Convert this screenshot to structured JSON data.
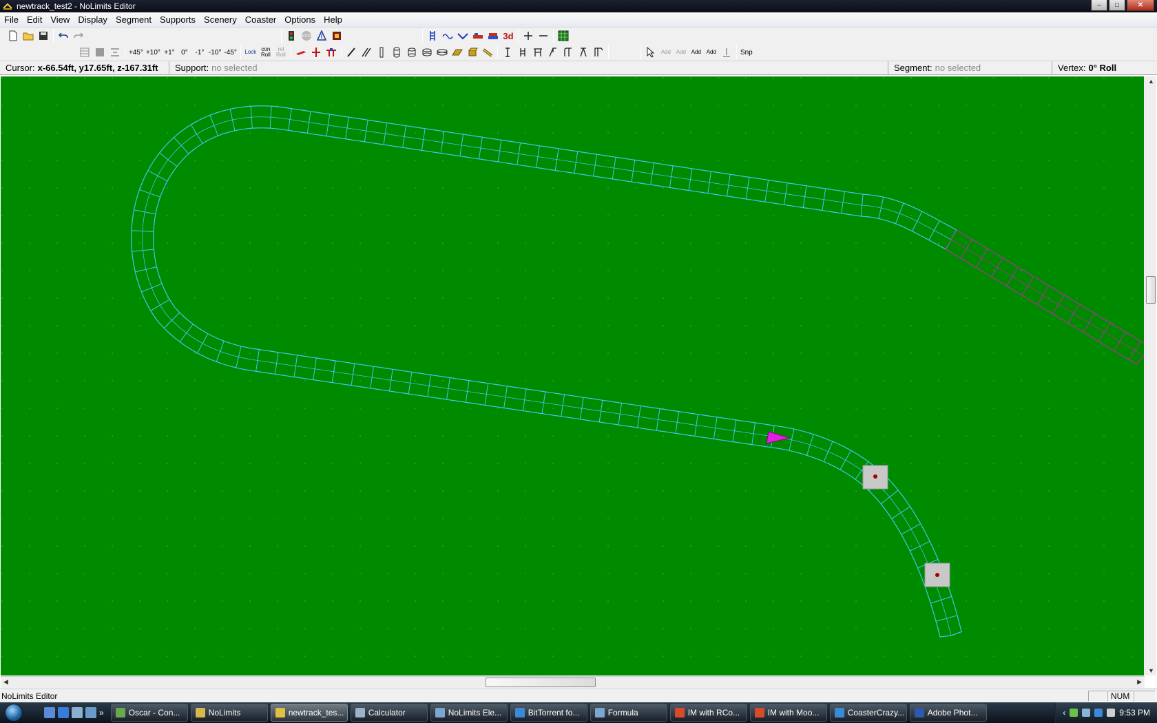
{
  "window": {
    "title": "newtrack_test2 - NoLimits Editor",
    "buttons": {
      "minimize": "–",
      "maximize": "□",
      "close": "✕"
    }
  },
  "menu": [
    "File",
    "Edit",
    "View",
    "Display",
    "Segment",
    "Supports",
    "Scenery",
    "Coaster",
    "Options",
    "Help"
  ],
  "toolbar2": {
    "rot_buttons": [
      "+45°",
      "+10°",
      "+1°",
      "0°",
      "-1°",
      "-10°",
      "-45°"
    ],
    "lock_roll": "Lock",
    "con_roll": "con Roll",
    "rel_roll": "rel Roll",
    "add_labels": [
      "Add",
      "Add",
      "Add",
      "Add"
    ],
    "snap": "Snp",
    "label_3d": "3d"
  },
  "info": {
    "cursor_label": "Cursor:",
    "cursor_value": "x-66.54ft, y17.65ft, z-167.31ft",
    "support_label": "Support:",
    "support_value": "no selected",
    "segment_label": "Segment:",
    "segment_value": "no selected",
    "vertex_label": "Vertex:",
    "vertex_value": "0° Roll"
  },
  "colors": {
    "ground": "#008a00",
    "track": "#3ec8f0",
    "track_selected": "#b030a0",
    "train_marker": "#e020e0",
    "support_base": "#c8c8c8"
  },
  "statusbar": {
    "text": "NoLimits Editor",
    "num": "NUM"
  },
  "taskbar": {
    "items": [
      {
        "label": "Oscar - Con...",
        "color": "#6aa84f"
      },
      {
        "label": "NoLimits",
        "color": "#d8b84a"
      },
      {
        "label": "newtrack_tes...",
        "color": "#e0c040",
        "active": true
      },
      {
        "label": "Calculator",
        "color": "#9fb3c8"
      },
      {
        "label": "NoLimits Ele...",
        "color": "#7aa6d0"
      },
      {
        "label": "BitTorrent fo...",
        "color": "#3a8ad8"
      },
      {
        "label": "Formula",
        "color": "#7aa6d0"
      },
      {
        "label": "IM with RCo...",
        "color": "#d84a2a"
      },
      {
        "label": "IM with Moo...",
        "color": "#d84a2a"
      },
      {
        "label": "CoasterCrazy...",
        "color": "#3a8ad8"
      },
      {
        "label": "Adobe Phot...",
        "color": "#2a5aa8"
      }
    ],
    "clock": "9:53 PM"
  }
}
